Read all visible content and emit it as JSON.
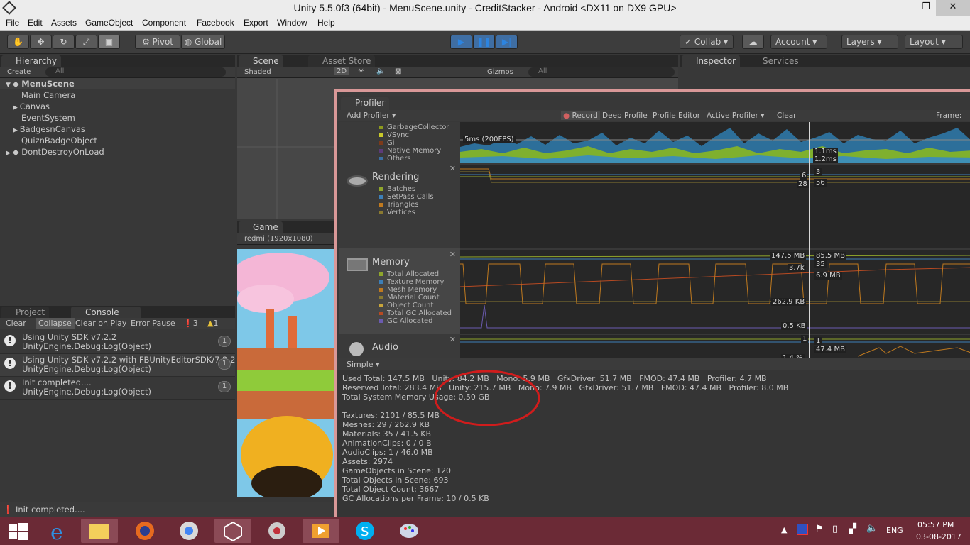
{
  "window": {
    "title": "Unity 5.5.0f3 (64bit) - MenuScene.unity - CreditStacker - Android <DX11 on DX9 GPU>",
    "min": "_",
    "max": "❐",
    "close": "✕"
  },
  "menu": [
    "File",
    "Edit",
    "Assets",
    "GameObject",
    "Component",
    "Facebook",
    "Export",
    "Window",
    "Help"
  ],
  "toolbar": {
    "tools": [
      "hand-tool",
      "move-tool",
      "rotate-tool",
      "scale-tool",
      "rect-tool"
    ],
    "pivot": "Pivot",
    "global": "Global",
    "collab": "Collab",
    "account": "Account",
    "layers": "Layers",
    "layout": "Layout"
  },
  "hierarchy": {
    "tab": "Hierarchy",
    "create": "Create",
    "search_placeholder": "All",
    "items": [
      {
        "label": "MenuScene",
        "level": 0,
        "scene": true
      },
      {
        "label": "Main Camera",
        "level": 1
      },
      {
        "label": "Canvas",
        "level": 1,
        "arrow": true
      },
      {
        "label": "EventSystem",
        "level": 1
      },
      {
        "label": "BadgesnCanvas",
        "level": 1,
        "arrow": true
      },
      {
        "label": "QuiznBadgeObject",
        "level": 1
      },
      {
        "label": "DontDestroyOnLoad",
        "level": 0,
        "scene": true
      }
    ]
  },
  "scene": {
    "tab": "Scene",
    "tab2": "Asset Store",
    "shaded": "Shaded",
    "twoD": "2D",
    "gizmos": "Gizmos",
    "search_placeholder": "All"
  },
  "game": {
    "tab": "Game",
    "resolution": "redmi (1920x1080)"
  },
  "inspector": {
    "tab": "Inspector",
    "services": "Services"
  },
  "console": {
    "tab_project": "Project",
    "tab_console": "Console",
    "buttons": [
      "Clear",
      "Collapse",
      "Clear on Play",
      "Error Pause"
    ],
    "counts": {
      "info": "3",
      "warn": "1"
    },
    "entries": [
      {
        "line1": "Using Unity SDK v7.2.2",
        "line2": "UnityEngine.Debug:Log(Object)",
        "count": "1"
      },
      {
        "line1": "Using Unity SDK v7.2.2 with FBUnityEditorSDK/7.2.2",
        "line2": "UnityEngine.Debug:Log(Object)",
        "count": "1"
      },
      {
        "line1": "Init completed....",
        "line2": "UnityEngine.Debug:Log(Object)",
        "count": "1"
      }
    ],
    "status": "Init completed...."
  },
  "profiler": {
    "tab": "Profiler",
    "add": "Add Profiler",
    "toolbar": [
      "Record",
      "Deep Profile",
      "Profile Editor",
      "Active Profiler",
      "Clear"
    ],
    "frame": "Frame:",
    "cpu_legend": [
      {
        "label": "GarbageCollector",
        "color": "#8d9a1e"
      },
      {
        "label": "VSync",
        "color": "#c8c82a"
      },
      {
        "label": "Gi",
        "color": "#7d3a1a"
      },
      {
        "label": "Native Memory",
        "color": "#5c3a7a"
      },
      {
        "label": "Others",
        "color": "#3b6fa3"
      }
    ],
    "cpu_labels": {
      "fps": "5ms (200FPS)",
      "a": "1.1ms",
      "b": "1.2ms"
    },
    "rendering": {
      "title": "Rendering",
      "legend": [
        {
          "label": "Batches",
          "color": "#8fa62b"
        },
        {
          "label": "SetPass Calls",
          "color": "#3c7fb8"
        },
        {
          "label": "Triangles",
          "color": "#c07a1f"
        },
        {
          "label": "Vertices",
          "color": "#8a7a30"
        }
      ],
      "vals": [
        "6",
        "3",
        "28",
        "56"
      ]
    },
    "memory": {
      "title": "Memory",
      "legend": [
        {
          "label": "Total Allocated",
          "color": "#8fa62b"
        },
        {
          "label": "Texture Memory",
          "color": "#3c7fb8"
        },
        {
          "label": "Mesh Memory",
          "color": "#c07a1f"
        },
        {
          "label": "Material Count",
          "color": "#8a7a30"
        },
        {
          "label": "Object Count",
          "color": "#c8a53b"
        },
        {
          "label": "Total GC Allocated",
          "color": "#b84a22"
        },
        {
          "label": "GC Allocated",
          "color": "#6b5bb0"
        }
      ],
      "vals": [
        "147.5 MB",
        "85.5 MB",
        "3.7k",
        "35",
        "6.9 MB",
        "262.9 KB",
        "0.5 KB"
      ]
    },
    "audio": {
      "title": "Audio",
      "vals": [
        "1",
        "1",
        "47.4 MB",
        "1.4 %"
      ]
    },
    "simple": "Simple",
    "stats_top": [
      "Used Total: 147.5 MB   Unity: 84.2 MB   Mono: 5.9 MB   GfxDriver: 51.7 MB   FMOD: 47.4 MB   Profiler: 4.7 MB",
      "Reserved Total: 283.4 MB   Unity: 215.7 MB   Mono: 7.9 MB   GfxDriver: 51.7 MB   FMOD: 47.4 MB   Profiler: 8.0 MB",
      "Total System Memory Usage: 0.50 GB"
    ],
    "stats_bottom": [
      "Textures: 2101 / 85.5 MB",
      "Meshes: 29 / 262.9 KB",
      "Materials: 35 / 41.5 KB",
      "AnimationClips: 0 / 0 B",
      "AudioClips: 1 / 46.0 MB",
      "Assets: 2974",
      "GameObjects in Scene: 120",
      "Total Objects in Scene: 693",
      "Total Object Count: 3667",
      "GC Allocations per Frame: 10 / 0.5 KB"
    ]
  },
  "taskbar": {
    "apps": [
      "start-button",
      "internet-explorer",
      "file-explorer",
      "firefox",
      "chrome",
      "unity",
      "media-app",
      "video-app",
      "skype",
      "paint-app"
    ],
    "lang": "ENG",
    "time": "05:57 PM",
    "date": "03-08-2017"
  }
}
